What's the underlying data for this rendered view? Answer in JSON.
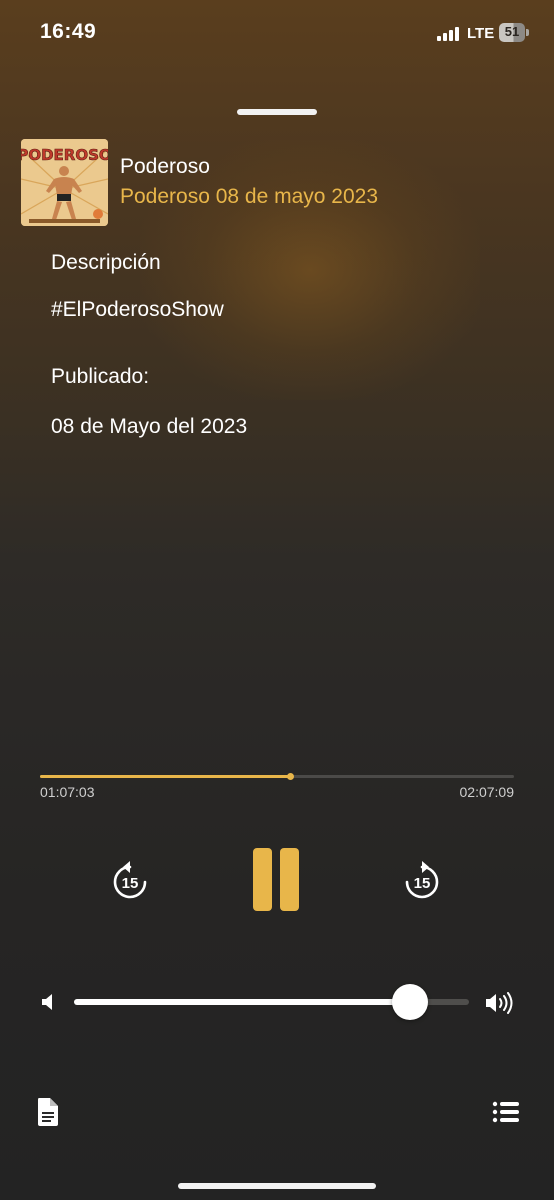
{
  "status_bar": {
    "time": "16:49",
    "network": "LTE",
    "battery": "51",
    "battery_level": 0.51,
    "signal_bars": 4
  },
  "episode": {
    "podcast_name": "Poderoso",
    "title": "Poderoso 08 de mayo 2023",
    "artwork_text": "PODEROSO",
    "description_label": "Descripción",
    "description": "#ElPoderosoShow",
    "published_label": "Publicado:",
    "published_date": "08 de Mayo del 2023"
  },
  "playback": {
    "elapsed": "01:07:03",
    "duration": "02:07:09",
    "progress_fraction": 0.527,
    "skip_back_seconds": "15",
    "skip_forward_seconds": "15",
    "state": "playing"
  },
  "volume": {
    "level_fraction": 0.85
  },
  "icons": {
    "skip_back": "rotate-back-15-icon",
    "pause": "pause-icon",
    "skip_forward": "rotate-forward-15-icon",
    "volume_low": "speaker-low-icon",
    "volume_high": "speaker-high-icon",
    "transcript": "document-icon",
    "queue": "list-icon"
  },
  "colors": {
    "accent": "#e8b64a",
    "text": "#ffffff",
    "secondary_text": "#cfcfcf"
  }
}
